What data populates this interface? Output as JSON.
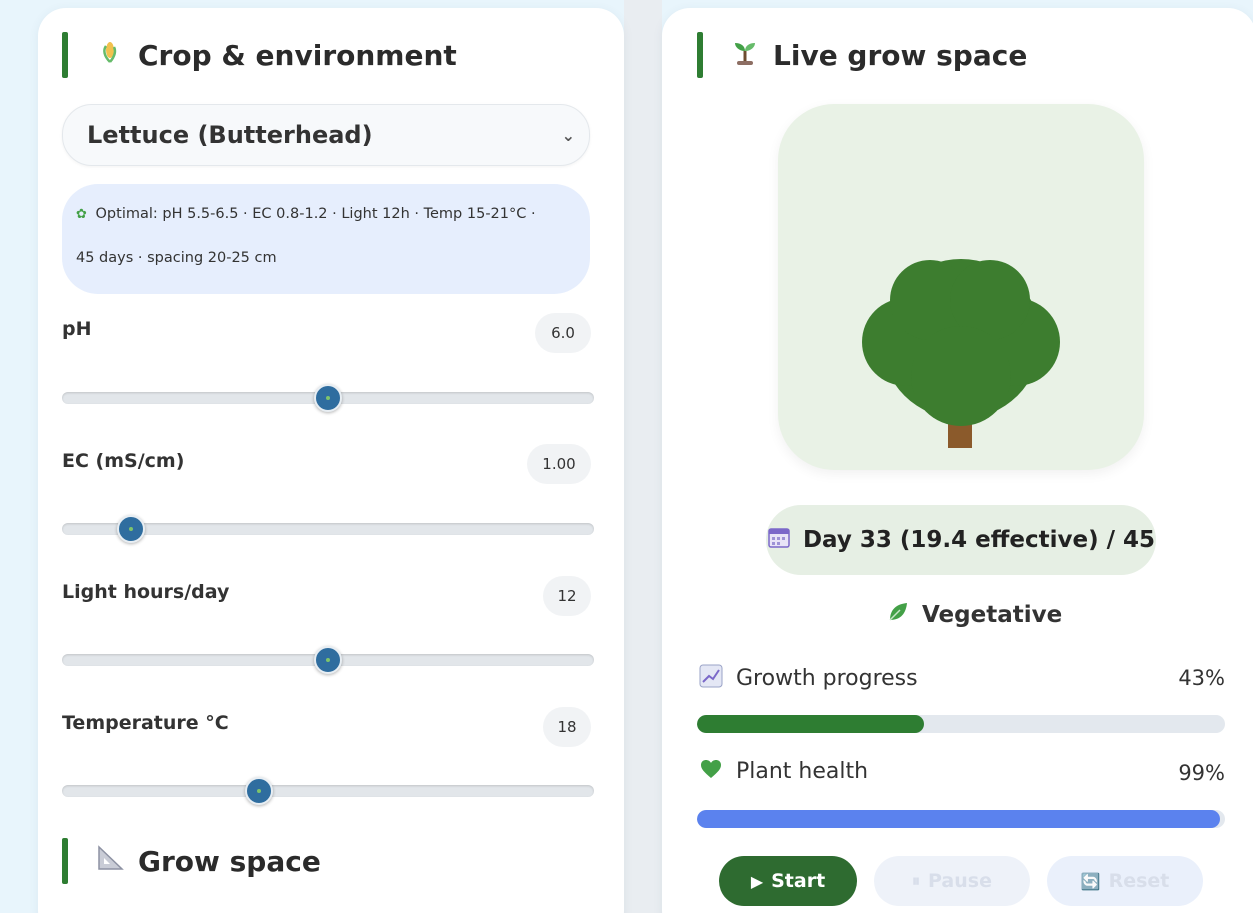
{
  "left": {
    "title": "Crop & environment",
    "crop_icon": "crop-icon",
    "crop_select": "Lettuce (Butterhead)",
    "optimal_line1": "Optimal: pH 5.5-6.5 · EC 0.8-1.2 · Light 12h · Temp 15-21°C ·",
    "optimal_line2": "45 days · spacing 20-25 cm",
    "sliders": [
      {
        "label": "pH",
        "value": "6.0",
        "fraction": 0.5
      },
      {
        "label": "EC (mS/cm)",
        "value": "1.00",
        "fraction": 0.13
      },
      {
        "label": "Light hours/day",
        "value": "12",
        "fraction": 0.5
      },
      {
        "label": "Temperature °C",
        "value": "18",
        "fraction": 0.37
      }
    ],
    "grow_space_title": "Grow space"
  },
  "right": {
    "title": "Live grow space",
    "day_text": "Day 33 (19.4 effective) / 45",
    "stage": "Vegetative",
    "growth_label": "Growth progress",
    "growth_value": "43%",
    "growth_fraction": 0.43,
    "health_label": "Plant health",
    "health_value": "99%",
    "health_fraction": 0.99,
    "buttons": {
      "start": "Start",
      "pause": "Pause",
      "reset": "Reset"
    }
  },
  "colors": {
    "accent_green": "#2e7d32",
    "growth_fill": "#2e7d32",
    "health_fill": "#5b82ee",
    "slider_thumb": "#2f6d9f",
    "tree_canopy": "#3d7d2f",
    "tree_trunk": "#8b5a2b"
  }
}
